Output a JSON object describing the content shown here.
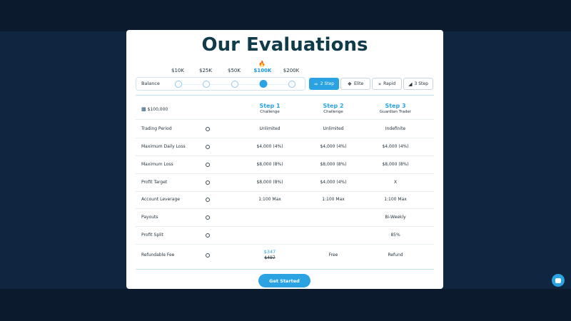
{
  "title": "Our Evaluations",
  "balance": {
    "label": "Balance",
    "options": [
      "$10K",
      "$25K",
      "$50K",
      "$100K",
      "$200K"
    ],
    "selected_index": 3
  },
  "plans": [
    {
      "label": "2 Step",
      "icon": "link-icon",
      "active": true
    },
    {
      "label": "Elite",
      "icon": "wings-icon",
      "active": false
    },
    {
      "label": "Rapid",
      "icon": "fast-forward-icon",
      "active": false
    },
    {
      "label": "3 Step",
      "icon": "chart-icon",
      "active": false
    }
  ],
  "table": {
    "account_label": "$100,000",
    "steps": [
      {
        "title": "Step 1",
        "subtitle": "Challenge"
      },
      {
        "title": "Step 2",
        "subtitle": "Challenge"
      },
      {
        "title": "Step 3",
        "subtitle": "Guardian Trader"
      }
    ],
    "rows": [
      {
        "label": "Trading Period",
        "values": [
          "Unlimited",
          "Unlimited",
          "Indefinite"
        ]
      },
      {
        "label": "Maximum Daily Loss",
        "values": [
          "$4,000 (4%)",
          "$4,000 (4%)",
          "$4,000 (4%)"
        ]
      },
      {
        "label": "Maximum Loss",
        "values": [
          "$8,000 (8%)",
          "$8,000 (8%)",
          "$8,000 (8%)"
        ]
      },
      {
        "label": "Profit Target",
        "values": [
          "$8,000 (8%)",
          "$4,000 (4%)",
          "X"
        ]
      },
      {
        "label": "Account Leverage",
        "values": [
          "1:100 Max",
          "1:100 Max",
          "1:100 Max"
        ]
      },
      {
        "label": "Payouts",
        "values": [
          "",
          "",
          "Bi-Weekly"
        ]
      },
      {
        "label": "Profit Split",
        "values": [
          "",
          "",
          "85%"
        ]
      },
      {
        "label": "Refundable Fee",
        "values": [
          "",
          "Free",
          "Refund"
        ]
      }
    ],
    "fee_price_new": "$347",
    "fee_price_old": "$497"
  },
  "cta_label": "Get Started",
  "colors": {
    "accent": "#2ba3e3",
    "title": "#0f3b4a",
    "background": "#102540"
  }
}
